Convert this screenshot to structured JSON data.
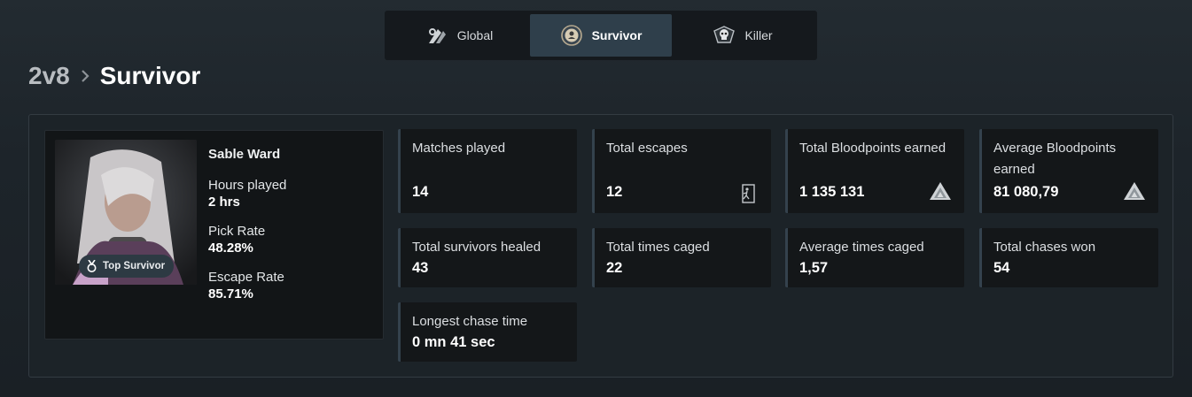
{
  "tabs": [
    {
      "label": "Global",
      "icon": "global-icon",
      "active": false
    },
    {
      "label": "Survivor",
      "icon": "survivor-icon",
      "active": true
    },
    {
      "label": "Killer",
      "icon": "killer-skull-icon",
      "active": false
    }
  ],
  "breadcrumb": {
    "parent": "2v8",
    "current": "Survivor"
  },
  "profile": {
    "name": "Sable Ward",
    "badge": "Top Survivor",
    "stats": [
      {
        "label": "Hours played",
        "value": "2 hrs"
      },
      {
        "label": "Pick Rate",
        "value": "48.28%"
      },
      {
        "label": "Escape Rate",
        "value": "85.71%"
      }
    ]
  },
  "cards": [
    {
      "title": "Matches played",
      "value": "14",
      "icon": ""
    },
    {
      "title": "Total escapes",
      "value": "12",
      "icon": "exit-door-icon"
    },
    {
      "title": "Total Bloodpoints earned",
      "value": "1 135 131",
      "icon": "bloodpoints-icon"
    },
    {
      "title": "Average Bloodpoints earned",
      "value": "81 080,79",
      "icon": "bloodpoints-icon"
    },
    {
      "title": "Total survivors healed",
      "value": "43",
      "icon": ""
    },
    {
      "title": "Total times caged",
      "value": "22",
      "icon": ""
    },
    {
      "title": "Average times caged",
      "value": "1,57",
      "icon": ""
    },
    {
      "title": "Total chases won",
      "value": "54",
      "icon": ""
    },
    {
      "title": "Longest chase time",
      "value": "0 mn 41 sec",
      "icon": ""
    }
  ],
  "colors": {
    "accent": "#2f3f4b",
    "background": "#1d242a",
    "card": "#141719"
  }
}
